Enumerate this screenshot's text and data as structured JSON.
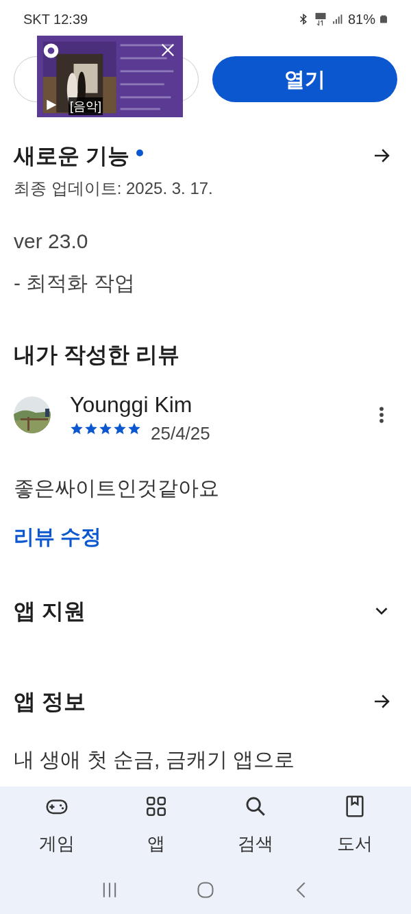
{
  "status_bar": {
    "carrier_time": "SKT 12:39",
    "battery": "81%"
  },
  "ad": {
    "kind": "picture",
    "caption": "[음악]"
  },
  "open_button": {
    "label": "열기"
  },
  "whats_new": {
    "title": "새로운 기능",
    "new_dot": true,
    "updated": "최종 업데이트: 2025. 3. 17.",
    "version": "ver 23.0",
    "notes": "- 최적화 작업"
  },
  "my_review": {
    "title": "내가 작성한 리뷰",
    "author": "Younggi Kim",
    "stars": 5,
    "date": "25/4/25",
    "text": "좋은싸이트인것같아요",
    "edit_link": "리뷰 수정"
  },
  "sections": [
    {
      "title": "앱 지원",
      "kind": "expand"
    },
    {
      "title": "앱 정보",
      "kind": "link"
    }
  ],
  "about_text": "내 생애 첫 순금, 금캐기 앱으로",
  "bottom_nav": [
    {
      "label": "게임",
      "kind": "games",
      "selected": false
    },
    {
      "label": "앱",
      "kind": "apps",
      "selected": false
    },
    {
      "label": "검색",
      "kind": "search",
      "selected": false
    },
    {
      "label": "도서",
      "kind": "books",
      "selected": false
    }
  ]
}
